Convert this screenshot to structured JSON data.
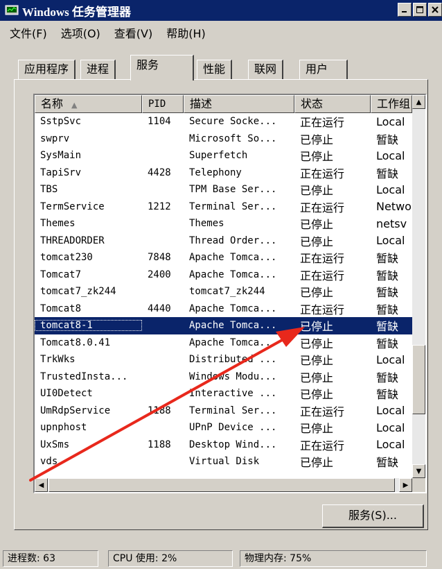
{
  "window": {
    "title": "Windows 任务管理器"
  },
  "menu": [
    "文件(F)",
    "选项(O)",
    "查看(V)",
    "帮助(H)"
  ],
  "tabs": [
    {
      "label": "应用程序"
    },
    {
      "label": "进程"
    },
    {
      "label": "服务",
      "active": true
    },
    {
      "label": "性能"
    },
    {
      "label": "联网"
    },
    {
      "label": "用户"
    }
  ],
  "columns": {
    "name": "名称",
    "pid": "PID",
    "desc": "描述",
    "status": "状态",
    "group": "工作组"
  },
  "rows": [
    {
      "name": "SstpSvc",
      "pid": "1104",
      "desc": "Secure Socke...",
      "status": "正在运行",
      "group": "Local"
    },
    {
      "name": "swprv",
      "pid": "",
      "desc": "Microsoft So...",
      "status": "已停止",
      "group": "暂缺"
    },
    {
      "name": "SysMain",
      "pid": "",
      "desc": "Superfetch",
      "status": "已停止",
      "group": "Local"
    },
    {
      "name": "TapiSrv",
      "pid": "4428",
      "desc": "Telephony",
      "status": "正在运行",
      "group": "暂缺"
    },
    {
      "name": "TBS",
      "pid": "",
      "desc": "TPM Base Ser...",
      "status": "已停止",
      "group": "Local"
    },
    {
      "name": "TermService",
      "pid": "1212",
      "desc": "Terminal Ser...",
      "status": "正在运行",
      "group": "Netwo"
    },
    {
      "name": "Themes",
      "pid": "",
      "desc": "Themes",
      "status": "已停止",
      "group": "netsv"
    },
    {
      "name": "THREADORDER",
      "pid": "",
      "desc": "Thread Order...",
      "status": "已停止",
      "group": "Local"
    },
    {
      "name": "tomcat230",
      "pid": "7848",
      "desc": "Apache Tomca...",
      "status": "正在运行",
      "group": "暂缺"
    },
    {
      "name": "Tomcat7",
      "pid": "2400",
      "desc": "Apache Tomca...",
      "status": "正在运行",
      "group": "暂缺"
    },
    {
      "name": "tomcat7_zk244",
      "pid": "",
      "desc": "tomcat7_zk244",
      "status": "已停止",
      "group": "暂缺"
    },
    {
      "name": "Tomcat8",
      "pid": "4440",
      "desc": "Apache Tomca...",
      "status": "正在运行",
      "group": "暂缺"
    },
    {
      "name": "tomcat8-1",
      "pid": "",
      "desc": "Apache Tomca...",
      "status": "已停止",
      "group": "暂缺",
      "selected": true
    },
    {
      "name": "Tomcat8.0.41",
      "pid": "",
      "desc": "Apache Tomca...",
      "status": "已停止",
      "group": "暂缺"
    },
    {
      "name": "TrkWks",
      "pid": "",
      "desc": "Distributed ...",
      "status": "已停止",
      "group": "Local"
    },
    {
      "name": "TrustedInsta...",
      "pid": "",
      "desc": "Windows Modu...",
      "status": "已停止",
      "group": "暂缺"
    },
    {
      "name": "UI0Detect",
      "pid": "",
      "desc": "Interactive ...",
      "status": "已停止",
      "group": "暂缺"
    },
    {
      "name": "UmRdpService",
      "pid": "1188",
      "desc": "Terminal Ser...",
      "status": "正在运行",
      "group": "Local"
    },
    {
      "name": "upnphost",
      "pid": "",
      "desc": "UPnP Device ...",
      "status": "已停止",
      "group": "Local"
    },
    {
      "name": "UxSms",
      "pid": "1188",
      "desc": "Desktop Wind...",
      "status": "正在运行",
      "group": "Local"
    },
    {
      "name": "vds",
      "pid": "",
      "desc": "Virtual Disk",
      "status": "已停止",
      "group": "暂缺"
    }
  ],
  "services_button": "服务(S)...",
  "status": {
    "processes": "进程数: 63",
    "cpu": "CPU 使用: 2%",
    "memory": "物理内存: 75%"
  },
  "annotation_color": "#e8281c"
}
